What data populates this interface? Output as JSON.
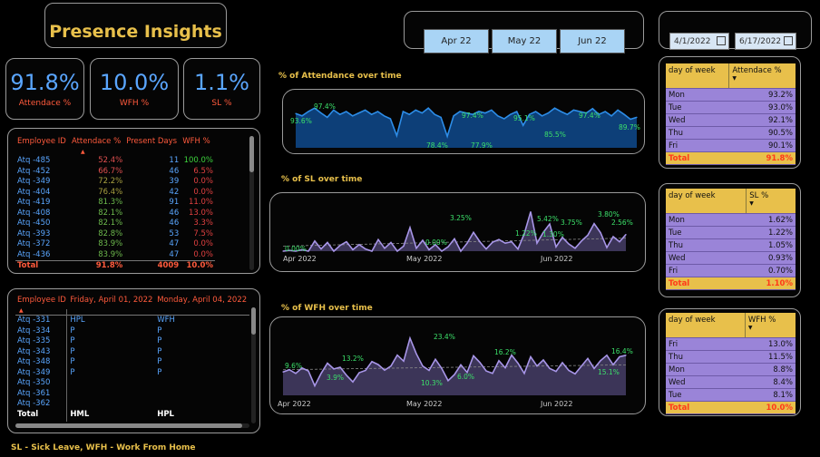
{
  "header": {
    "title": "Presence Insights"
  },
  "month_slicer": [
    "Apr 22",
    "May 22",
    "Jun 22"
  ],
  "date_range": {
    "start": "4/1/2022",
    "end": "6/17/2022"
  },
  "kpis": [
    {
      "value": "91.8%",
      "label": "Attendace %"
    },
    {
      "value": "10.0%",
      "label": "WFH %"
    },
    {
      "value": "1.1%",
      "label": "SL %"
    }
  ],
  "employee_table": {
    "columns": [
      "Employee ID",
      "Attendace %",
      "Present Days",
      "WFH %"
    ],
    "rows": [
      [
        "Atq -485",
        "52.4%",
        "11",
        "100.0%"
      ],
      [
        "Atq -452",
        "66.7%",
        "46",
        "6.5%"
      ],
      [
        "Atq -349",
        "72.2%",
        "39",
        "0.0%"
      ],
      [
        "Atq -404",
        "76.4%",
        "42",
        "0.0%"
      ],
      [
        "Atq -419",
        "81.3%",
        "91",
        "11.0%"
      ],
      [
        "Atq -408",
        "82.1%",
        "46",
        "13.0%"
      ],
      [
        "Atq -450",
        "82.1%",
        "46",
        "3.3%"
      ],
      [
        "Atq -393",
        "82.8%",
        "53",
        "7.5%"
      ],
      [
        "Atq -372",
        "83.9%",
        "47",
        "0.0%"
      ],
      [
        "Atq -436",
        "83.9%",
        "47",
        "0.0%"
      ]
    ],
    "total": [
      "Total",
      "91.8%",
      "4009",
      "10.0%"
    ]
  },
  "matrix_table": {
    "columns": [
      "Employee ID",
      "Friday, April 01, 2022",
      "Monday, April 04, 2022"
    ],
    "rows": [
      [
        "Atq -331",
        "HPL",
        "WFH"
      ],
      [
        "Atq -334",
        "P",
        "P"
      ],
      [
        "Atq -335",
        "P",
        "P"
      ],
      [
        "Atq -343",
        "P",
        "P"
      ],
      [
        "Atq -348",
        "P",
        "P"
      ],
      [
        "Atq -349",
        "P",
        "P"
      ],
      [
        "Atq -350",
        "",
        ""
      ],
      [
        "Atq -361",
        "",
        ""
      ],
      [
        "Atq -362",
        "",
        ""
      ]
    ],
    "total": [
      "Total",
      "HML",
      "HPL"
    ]
  },
  "footer_note": "SL - Sick Leave, WFH - Work From Home",
  "charts": {
    "attendance": {
      "title": "% of Attendance over time",
      "labels": [
        "93.6%",
        "97.4%",
        "78.4%",
        "97.4%",
        "77.9%",
        "95.1%",
        "85.5%",
        "97.4%",
        "89.7%"
      ]
    },
    "sl": {
      "title": "% of SL over time",
      "labels": [
        "0.00%",
        "3.25%",
        "0.00%",
        "1.22%",
        "1.30%",
        "5.42%",
        "3.75%",
        "3.80%",
        "2.56%"
      ],
      "ticks": [
        "Apr 2022",
        "May 2022",
        "Jun 2022"
      ]
    },
    "wfh": {
      "title": "% of WFH over time",
      "labels": [
        "9.6%",
        "3.9%",
        "13.2%",
        "10.3%",
        "23.4%",
        "6.0%",
        "16.2%",
        "15.1%",
        "16.4%"
      ],
      "ticks": [
        "Apr 2022",
        "May 2022",
        "Jun 2022"
      ]
    }
  },
  "chart_data": [
    {
      "type": "area",
      "title": "% of Attendance over time",
      "ylabel": "",
      "xlabel": "",
      "x": [
        "Apr",
        "",
        "",
        "",
        "",
        "",
        "",
        "",
        "",
        "",
        "",
        "",
        "",
        "",
        "",
        "",
        "",
        "",
        "",
        "",
        "",
        "",
        "",
        "",
        "",
        "",
        "",
        "",
        "",
        "",
        "",
        "",
        "",
        "",
        "",
        "",
        "",
        "",
        "",
        "",
        "",
        "",
        "",
        "",
        "",
        "",
        "",
        "",
        "",
        "",
        "",
        "",
        "",
        "",
        ""
      ],
      "values": [
        93.6,
        92,
        95,
        97.4,
        94,
        91,
        96,
        93,
        95,
        92,
        94,
        96,
        93,
        95,
        92,
        90,
        78.4,
        95,
        93,
        96,
        94,
        97.4,
        93,
        91,
        77.9,
        92,
        95,
        94,
        93,
        95.1,
        94,
        96,
        92,
        90,
        93,
        95,
        85.5,
        93,
        95,
        92,
        94,
        97.4,
        95,
        93,
        96,
        95,
        94,
        97,
        93,
        95,
        92,
        96,
        93,
        89.7,
        91
      ]
    },
    {
      "type": "area",
      "title": "% of SL over time",
      "values": [
        0.0,
        0.1,
        0.0,
        0.2,
        0.0,
        1.4,
        0.3,
        1.2,
        0.0,
        0.8,
        1.3,
        0.2,
        0.9,
        0.3,
        0.0,
        1.6,
        0.4,
        1.2,
        0.0,
        0.7,
        3.25,
        0.4,
        1.5,
        0.2,
        0.9,
        0.0,
        0.6,
        1.7,
        0.0,
        1.1,
        2.6,
        1.3,
        0.3,
        1.22,
        1.6,
        1.1,
        1.3,
        0.3,
        2.4,
        5.42,
        1.1,
        2.6,
        3.75,
        0.6,
        1.9,
        1.0,
        0.4,
        1.4,
        2.2,
        3.8,
        2.56,
        0.5,
        2.0,
        1.3,
        2.3
      ],
      "ticks": [
        "Apr 2022",
        "May 2022",
        "Jun 2022"
      ]
    },
    {
      "type": "area",
      "title": "% of WFH over time",
      "values": [
        9.6,
        10.5,
        9.0,
        11.2,
        10.0,
        3.9,
        9.0,
        13.2,
        10.8,
        11.5,
        8.2,
        5.5,
        9.3,
        10.2,
        13.8,
        12.6,
        10.3,
        12.0,
        16.5,
        14.0,
        23.4,
        17.0,
        12.0,
        10.2,
        14.8,
        11.0,
        6.0,
        8.5,
        12.5,
        9.4,
        16.2,
        13.5,
        10.0,
        9.0,
        14.2,
        11.3,
        16.5,
        13.2,
        9.0,
        15.8,
        12.0,
        14.5,
        11.0,
        9.8,
        13.4,
        10.2,
        8.8,
        12.0,
        15.1,
        11.0,
        14.2,
        16.4,
        12.5,
        15.8,
        16.4
      ],
      "ticks": [
        "Apr 2022",
        "May 2022",
        "Jun 2022"
      ]
    }
  ],
  "dow_tables": [
    {
      "col1": "day of week",
      "col2": "Attendace %",
      "rows": [
        [
          "Mon",
          "93.2%"
        ],
        [
          "Tue",
          "93.0%"
        ],
        [
          "Wed",
          "92.1%"
        ],
        [
          "Thu",
          "90.5%"
        ],
        [
          "Fri",
          "90.1%"
        ]
      ],
      "total": [
        "Total",
        "91.8%"
      ]
    },
    {
      "col1": "day of week",
      "col2": "SL %",
      "rows": [
        [
          "Mon",
          "1.62%"
        ],
        [
          "Tue",
          "1.22%"
        ],
        [
          "Thu",
          "1.05%"
        ],
        [
          "Wed",
          "0.93%"
        ],
        [
          "Fri",
          "0.70%"
        ]
      ],
      "total": [
        "Total",
        "1.10%"
      ]
    },
    {
      "col1": "day of week",
      "col2": "WFH %",
      "rows": [
        [
          "Fri",
          "13.0%"
        ],
        [
          "Thu",
          "11.5%"
        ],
        [
          "Mon",
          "8.8%"
        ],
        [
          "Wed",
          "8.4%"
        ],
        [
          "Tue",
          "8.1%"
        ]
      ],
      "total": [
        "Total",
        "10.0%"
      ]
    }
  ]
}
